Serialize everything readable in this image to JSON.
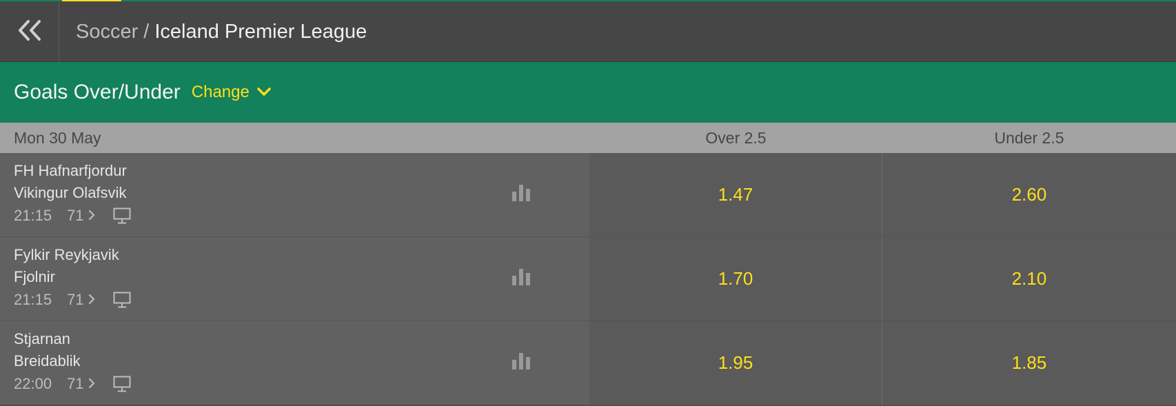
{
  "breadcrumb": {
    "parent": "Soccer",
    "separator": "/",
    "current": "Iceland Premier League"
  },
  "market": {
    "title": "Goals Over/Under",
    "change_label": "Change"
  },
  "columns": {
    "date": "Mon 30 May",
    "over": "Over 2.5",
    "under": "Under 2.5"
  },
  "matches": [
    {
      "home": "FH Hafnarfjordur",
      "away": "Vikingur Olafsvik",
      "time": "21:15",
      "markets": "71",
      "over": "1.47",
      "under": "2.60"
    },
    {
      "home": "Fylkir Reykjavik",
      "away": "Fjolnir",
      "time": "21:15",
      "markets": "71",
      "over": "1.70",
      "under": "2.10"
    },
    {
      "home": "Stjarnan",
      "away": "Breidablik",
      "time": "22:00",
      "markets": "71",
      "over": "1.95",
      "under": "1.85"
    }
  ],
  "icons": {
    "back": "double-chevron-left-icon",
    "change": "chevron-down-icon",
    "stats": "bar-chart-icon",
    "tv": "monitor-icon",
    "more": "chevron-right-icon"
  },
  "colors": {
    "brand_green": "#13815b",
    "odds_yellow": "#ffdf1b",
    "header_bg": "#464646",
    "row_bg": "#616161"
  }
}
